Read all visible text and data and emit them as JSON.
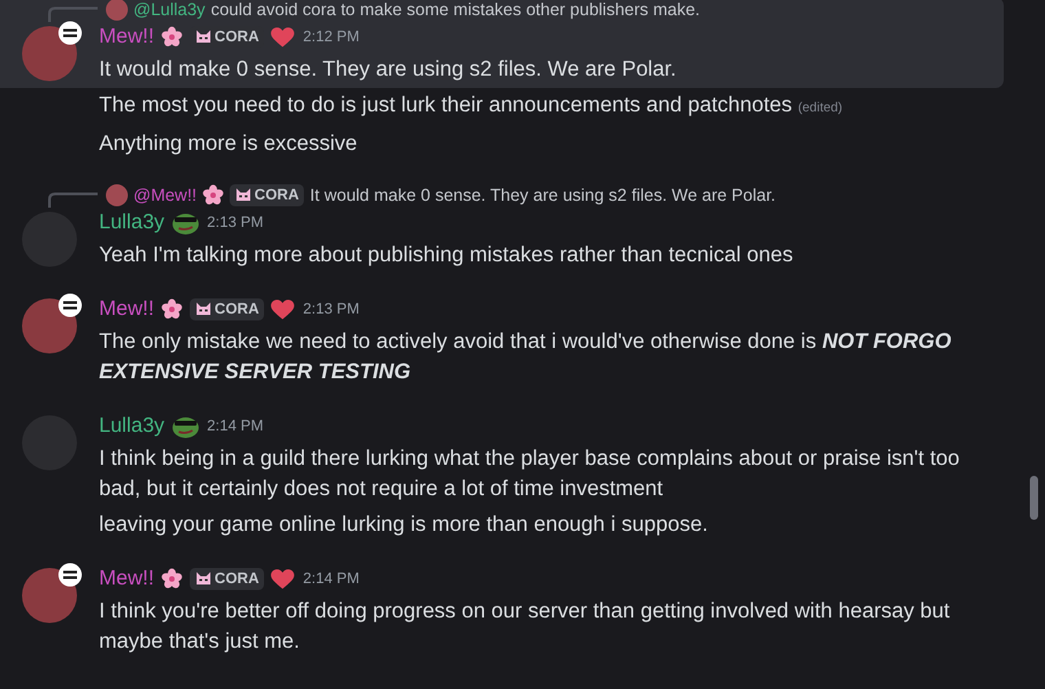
{
  "messages": [
    {
      "author": "Mew!!",
      "color": "#c94fc0",
      "badges": [
        {
          "kind": "flower"
        },
        {
          "kind": "tag",
          "text": "CORA"
        },
        {
          "kind": "heart"
        }
      ],
      "time": "2:12 PM",
      "highlighted": true,
      "reply": {
        "mention": "@Lulla3y",
        "color": "#43b581",
        "text": "could avoid cora to make some mistakes other publishers make."
      },
      "lines": [
        {
          "text": "It would make 0 sense. They are using s2 files. We are Polar."
        },
        {
          "text": "The most you need to do is just lurk their announcements and patchnotes",
          "edited": "(edited)"
        },
        {
          "text": "Anything more is excessive"
        }
      ]
    },
    {
      "author": "Lulla3y",
      "color": "#43b581",
      "badges": [
        {
          "kind": "frog"
        }
      ],
      "time": "2:13 PM",
      "highlighted": false,
      "reply": {
        "mention": "@Mew!!",
        "color": "#c94fc0",
        "badges": [
          {
            "kind": "flower"
          },
          {
            "kind": "tag",
            "text": "CORA"
          }
        ],
        "text": "It would make 0 sense. They are using s2 files. We are Polar."
      },
      "lines": [
        {
          "text": "Yeah I'm talking more about publishing mistakes rather than tecnical ones"
        }
      ]
    },
    {
      "author": "Mew!!",
      "color": "#c94fc0",
      "badges": [
        {
          "kind": "flower"
        },
        {
          "kind": "tag",
          "text": "CORA"
        },
        {
          "kind": "heart"
        }
      ],
      "time": "2:13 PM",
      "highlighted": false,
      "lines": [
        {
          "text": "The only mistake we need to actively avoid that i would've otherwise done is **NOT FORGO EXTENSIVE SERVER TESTING**"
        }
      ]
    },
    {
      "author": "Lulla3y",
      "color": "#43b581",
      "badges": [
        {
          "kind": "frog"
        }
      ],
      "time": "2:14 PM",
      "highlighted": false,
      "lines": [
        {
          "text": "I think being in a guild there lurking what the player base complains about or praise isn't too bad, but it certainly does not require a lot of time investment"
        },
        {
          "text": "leaving your game online lurking is more than enough i suppose."
        }
      ]
    },
    {
      "author": "Mew!!",
      "color": "#c94fc0",
      "badges": [
        {
          "kind": "flower"
        },
        {
          "kind": "tag",
          "text": "CORA"
        },
        {
          "kind": "heart"
        }
      ],
      "time": "2:14 PM",
      "highlighted": false,
      "lines": [
        {
          "text": "I think you're better off doing progress on our server than getting involved with hearsay but maybe that's just me."
        }
      ]
    }
  ]
}
